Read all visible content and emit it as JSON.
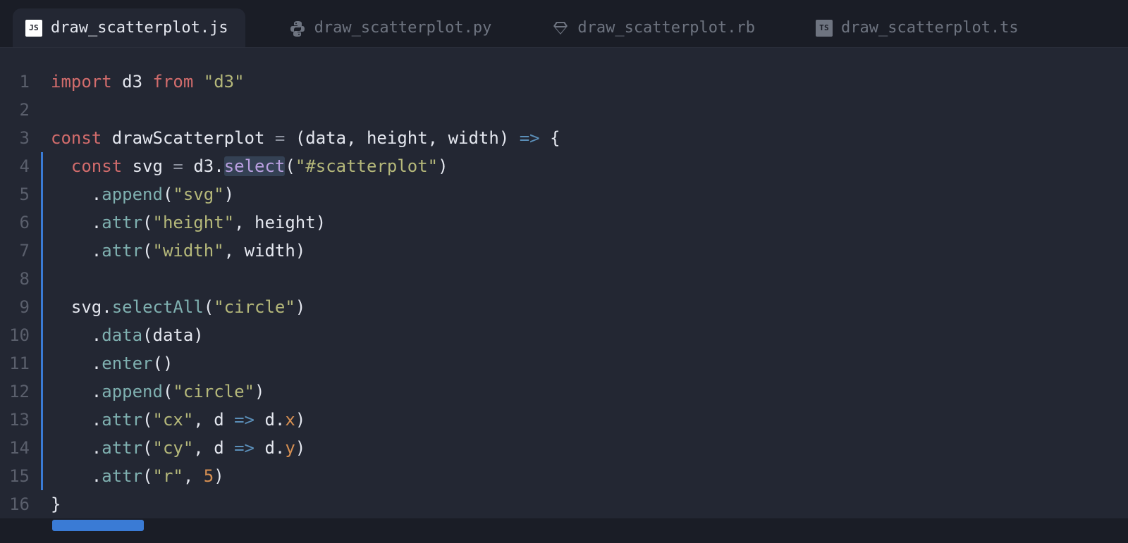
{
  "tabs": [
    {
      "label": "draw_scatterplot.js",
      "icon": "js",
      "active": true
    },
    {
      "label": "draw_scatterplot.py",
      "icon": "py",
      "active": false
    },
    {
      "label": "draw_scatterplot.rb",
      "icon": "rb",
      "active": false
    },
    {
      "label": "draw_scatterplot.ts",
      "icon": "ts",
      "active": false
    }
  ],
  "code": {
    "lines": [
      {
        "n": 1,
        "guide": false,
        "tokens": [
          [
            "kw",
            "import"
          ],
          [
            "sp",
            " "
          ],
          [
            "id",
            "d3"
          ],
          [
            "sp",
            " "
          ],
          [
            "kw",
            "from"
          ],
          [
            "sp",
            " "
          ],
          [
            "str",
            "\"d3\""
          ]
        ]
      },
      {
        "n": 2,
        "guide": false,
        "tokens": []
      },
      {
        "n": 3,
        "guide": false,
        "tokens": [
          [
            "kw",
            "const"
          ],
          [
            "sp",
            " "
          ],
          [
            "declname",
            "drawScatterplot"
          ],
          [
            "sp",
            " "
          ],
          [
            "op",
            "="
          ],
          [
            "sp",
            " "
          ],
          [
            "pn",
            "("
          ],
          [
            "id",
            "data"
          ],
          [
            "pn",
            ","
          ],
          [
            "sp",
            " "
          ],
          [
            "id",
            "height"
          ],
          [
            "pn",
            ","
          ],
          [
            "sp",
            " "
          ],
          [
            "id",
            "width"
          ],
          [
            "pn",
            ")"
          ],
          [
            "sp",
            " "
          ],
          [
            "op2",
            "=>"
          ],
          [
            "sp",
            " "
          ],
          [
            "pn",
            "{"
          ]
        ]
      },
      {
        "n": 4,
        "guide": true,
        "tokens": [
          [
            "sp",
            "  "
          ],
          [
            "kw",
            "const"
          ],
          [
            "sp",
            " "
          ],
          [
            "id",
            "svg"
          ],
          [
            "sp",
            " "
          ],
          [
            "op",
            "="
          ],
          [
            "sp",
            " "
          ],
          [
            "id",
            "d3"
          ],
          [
            "pn",
            "."
          ],
          [
            "call-hl",
            "select"
          ],
          [
            "pn",
            "("
          ],
          [
            "str",
            "\"#scatterplot\""
          ],
          [
            "pn",
            ")"
          ]
        ]
      },
      {
        "n": 5,
        "guide": true,
        "tokens": [
          [
            "sp",
            "    "
          ],
          [
            "pn",
            "."
          ],
          [
            "call",
            "append"
          ],
          [
            "pn",
            "("
          ],
          [
            "str",
            "\"svg\""
          ],
          [
            "pn",
            ")"
          ]
        ]
      },
      {
        "n": 6,
        "guide": true,
        "tokens": [
          [
            "sp",
            "    "
          ],
          [
            "pn",
            "."
          ],
          [
            "call",
            "attr"
          ],
          [
            "pn",
            "("
          ],
          [
            "str",
            "\"height\""
          ],
          [
            "pn",
            ","
          ],
          [
            "sp",
            " "
          ],
          [
            "id",
            "height"
          ],
          [
            "pn",
            ")"
          ]
        ]
      },
      {
        "n": 7,
        "guide": true,
        "tokens": [
          [
            "sp",
            "    "
          ],
          [
            "pn",
            "."
          ],
          [
            "call",
            "attr"
          ],
          [
            "pn",
            "("
          ],
          [
            "str",
            "\"width\""
          ],
          [
            "pn",
            ","
          ],
          [
            "sp",
            " "
          ],
          [
            "id",
            "width"
          ],
          [
            "pn",
            ")"
          ]
        ]
      },
      {
        "n": 8,
        "guide": true,
        "tokens": []
      },
      {
        "n": 9,
        "guide": true,
        "tokens": [
          [
            "sp",
            "  "
          ],
          [
            "id",
            "svg"
          ],
          [
            "pn",
            "."
          ],
          [
            "call",
            "selectAll"
          ],
          [
            "pn",
            "("
          ],
          [
            "str",
            "\"circle\""
          ],
          [
            "pn",
            ")"
          ]
        ]
      },
      {
        "n": 10,
        "guide": true,
        "tokens": [
          [
            "sp",
            "    "
          ],
          [
            "pn",
            "."
          ],
          [
            "call",
            "data"
          ],
          [
            "pn",
            "("
          ],
          [
            "id",
            "data"
          ],
          [
            "pn",
            ")"
          ]
        ]
      },
      {
        "n": 11,
        "guide": true,
        "tokens": [
          [
            "sp",
            "    "
          ],
          [
            "pn",
            "."
          ],
          [
            "call",
            "enter"
          ],
          [
            "pn",
            "("
          ],
          [
            "pn",
            ")"
          ]
        ]
      },
      {
        "n": 12,
        "guide": true,
        "tokens": [
          [
            "sp",
            "    "
          ],
          [
            "pn",
            "."
          ],
          [
            "call",
            "append"
          ],
          [
            "pn",
            "("
          ],
          [
            "str",
            "\"circle\""
          ],
          [
            "pn",
            ")"
          ]
        ]
      },
      {
        "n": 13,
        "guide": true,
        "tokens": [
          [
            "sp",
            "    "
          ],
          [
            "pn",
            "."
          ],
          [
            "call",
            "attr"
          ],
          [
            "pn",
            "("
          ],
          [
            "str",
            "\"cx\""
          ],
          [
            "pn",
            ","
          ],
          [
            "sp",
            " "
          ],
          [
            "id",
            "d"
          ],
          [
            "sp",
            " "
          ],
          [
            "op2",
            "=>"
          ],
          [
            "sp",
            " "
          ],
          [
            "id",
            "d"
          ],
          [
            "pn",
            "."
          ],
          [
            "prop",
            "x"
          ],
          [
            "pn",
            ")"
          ]
        ]
      },
      {
        "n": 14,
        "guide": true,
        "tokens": [
          [
            "sp",
            "    "
          ],
          [
            "pn",
            "."
          ],
          [
            "call",
            "attr"
          ],
          [
            "pn",
            "("
          ],
          [
            "str",
            "\"cy\""
          ],
          [
            "pn",
            ","
          ],
          [
            "sp",
            " "
          ],
          [
            "id",
            "d"
          ],
          [
            "sp",
            " "
          ],
          [
            "op2",
            "=>"
          ],
          [
            "sp",
            " "
          ],
          [
            "id",
            "d"
          ],
          [
            "pn",
            "."
          ],
          [
            "prop",
            "y"
          ],
          [
            "pn",
            ")"
          ]
        ]
      },
      {
        "n": 15,
        "guide": true,
        "tokens": [
          [
            "sp",
            "    "
          ],
          [
            "pn",
            "."
          ],
          [
            "call",
            "attr"
          ],
          [
            "pn",
            "("
          ],
          [
            "str",
            "\"r\""
          ],
          [
            "pn",
            ","
          ],
          [
            "sp",
            " "
          ],
          [
            "num",
            "5"
          ],
          [
            "pn",
            ")"
          ]
        ]
      },
      {
        "n": 16,
        "guide": false,
        "tokens": [
          [
            "pn",
            "}"
          ]
        ]
      }
    ]
  }
}
